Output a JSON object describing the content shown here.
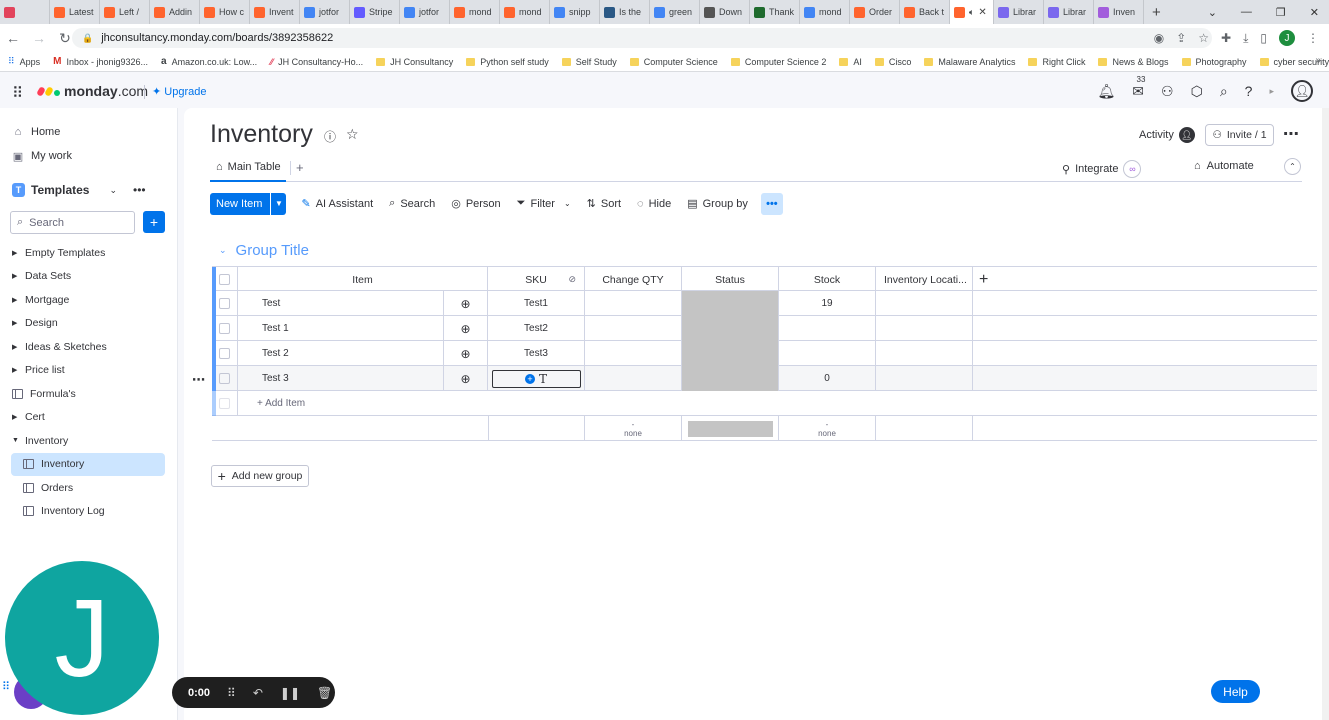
{
  "browser": {
    "tabs": [
      {
        "label": "",
        "color": "#e2445c",
        "icon": "record-icon"
      },
      {
        "label": "Latest",
        "color": "#ff642e",
        "icon": "monday-icon"
      },
      {
        "label": "Left /",
        "color": "#ff642e",
        "icon": "monday-icon"
      },
      {
        "label": "Addin",
        "color": "#ff642e",
        "icon": "monday-icon"
      },
      {
        "label": "How c",
        "color": "#ff642e",
        "icon": "monday-icon"
      },
      {
        "label": "Invent",
        "color": "#ff642e",
        "icon": "monday-icon"
      },
      {
        "label": "jotfor",
        "color": "#4285f4",
        "icon": "google-icon"
      },
      {
        "label": "Stripe",
        "color": "#635bff",
        "icon": "stripe-icon"
      },
      {
        "label": "jotfor",
        "color": "#4285f4",
        "icon": "google-icon"
      },
      {
        "label": "mond",
        "color": "#ff642e",
        "icon": "monday-icon"
      },
      {
        "label": "mond",
        "color": "#ff642e",
        "icon": "monday-icon"
      },
      {
        "label": "snipp",
        "color": "#4285f4",
        "icon": "google-icon"
      },
      {
        "label": "Is the",
        "color": "#2a5885",
        "icon": "doc-icon"
      },
      {
        "label": "green",
        "color": "#4285f4",
        "icon": "google-icon"
      },
      {
        "label": "Down",
        "color": "#555555",
        "icon": "globe-icon"
      },
      {
        "label": "Thank",
        "color": "#1f6b2e",
        "icon": "nvidia-icon"
      },
      {
        "label": "mond",
        "color": "#4285f4",
        "icon": "google-icon"
      },
      {
        "label": "Order",
        "color": "#ff642e",
        "icon": "monday-icon"
      },
      {
        "label": "Back t",
        "color": "#ff642e",
        "icon": "monday-icon"
      },
      {
        "label": "",
        "color": "#ff642e",
        "icon": "monday-icon",
        "active": true
      },
      {
        "label": "Librar",
        "color": "#7b68ee",
        "icon": "gear-icon"
      },
      {
        "label": "Librar",
        "color": "#7b68ee",
        "icon": "gear-icon"
      },
      {
        "label": "Inven",
        "color": "#a25ddc",
        "icon": "monday-icon"
      }
    ],
    "url": "jhconsultancy.monday.com/boards/3892358622",
    "profile_letter": "J",
    "bookmarks": [
      {
        "label": "Apps",
        "kind": "apps"
      },
      {
        "label": "Inbox - jhonig9326...",
        "kind": "gmail"
      },
      {
        "label": "Amazon.co.uk: Low...",
        "kind": "amazon"
      },
      {
        "label": "JH Consultancy-Ho...",
        "kind": "monday"
      },
      {
        "label": "JH Consultancy",
        "kind": "folder"
      },
      {
        "label": "Python self study",
        "kind": "folder"
      },
      {
        "label": "Self Study",
        "kind": "folder"
      },
      {
        "label": "Computer Science",
        "kind": "folder"
      },
      {
        "label": "Computer Science 2",
        "kind": "folder"
      },
      {
        "label": "AI",
        "kind": "folder"
      },
      {
        "label": "Cisco",
        "kind": "folder"
      },
      {
        "label": "Malaware Analytics",
        "kind": "folder"
      },
      {
        "label": "Right Click",
        "kind": "folder"
      },
      {
        "label": "News & Blogs",
        "kind": "folder"
      },
      {
        "label": "Photography",
        "kind": "folder"
      },
      {
        "label": "cyber security",
        "kind": "folder"
      }
    ]
  },
  "header": {
    "logo_name": "monday",
    "logo_suffix": ".com",
    "upgrade_label": "Upgrade",
    "inbox_badge": "33"
  },
  "sidebar": {
    "nav": [
      {
        "label": "Home",
        "icon": "home-icon"
      },
      {
        "label": "My work",
        "icon": "calendar-icon"
      }
    ],
    "workspace": {
      "letter": "T",
      "name": "Templates"
    },
    "search_placeholder": "Search",
    "tree": [
      {
        "label": "Empty Templates",
        "type": "folder"
      },
      {
        "label": "Data Sets",
        "type": "folder"
      },
      {
        "label": "Mortgage",
        "type": "folder"
      },
      {
        "label": "Design",
        "type": "folder"
      },
      {
        "label": "Ideas & Sketches",
        "type": "folder"
      },
      {
        "label": "Price list",
        "type": "folder"
      },
      {
        "label": "Formula's",
        "type": "board"
      },
      {
        "label": "Cert",
        "type": "folder"
      },
      {
        "label": "Inventory",
        "type": "folder-open"
      },
      {
        "label": "Inventory",
        "type": "sub-board",
        "active": true
      },
      {
        "label": "Orders",
        "type": "sub-board"
      },
      {
        "label": "Inventory Log",
        "type": "sub-board"
      }
    ]
  },
  "board": {
    "title": "Inventory",
    "activity_label": "Activity",
    "invite_label": "Invite / 1",
    "view_tab": "Main Table",
    "integrate_label": "Integrate",
    "automate_label": "Automate",
    "toolbar": {
      "new_item": "New Item",
      "ai_assistant": "AI Assistant",
      "search": "Search",
      "person": "Person",
      "filter": "Filter",
      "sort": "Sort",
      "hide": "Hide",
      "group_by": "Group by"
    },
    "group": {
      "title": "Group Title",
      "color": "#579bfc",
      "columns": {
        "item": "Item",
        "sku": "SKU",
        "change_qty": "Change QTY",
        "status": "Status",
        "stock": "Stock",
        "location": "Inventory Locati..."
      },
      "rows": [
        {
          "item": "Test",
          "sku": "Test1",
          "stock": "19"
        },
        {
          "item": "Test 1",
          "sku": "Test2",
          "stock": ""
        },
        {
          "item": "Test 2",
          "sku": "Test3",
          "stock": ""
        },
        {
          "item": "Test 3",
          "sku": "",
          "stock": "0",
          "editing": true
        }
      ],
      "add_item_label": "+ Add Item",
      "summary": {
        "change_qty_dash": "-",
        "change_qty_value": "none",
        "stock_dash": "-",
        "stock_value": "none"
      }
    },
    "add_group_label": "Add new group"
  },
  "overlays": {
    "avatar_letter": "J",
    "recorder_time": "0:00",
    "help_label": "Help"
  },
  "colors": {
    "primary": "#0073ea",
    "status_empty": "#c4c4c4",
    "avatar_teal": "#0fa5a0"
  }
}
